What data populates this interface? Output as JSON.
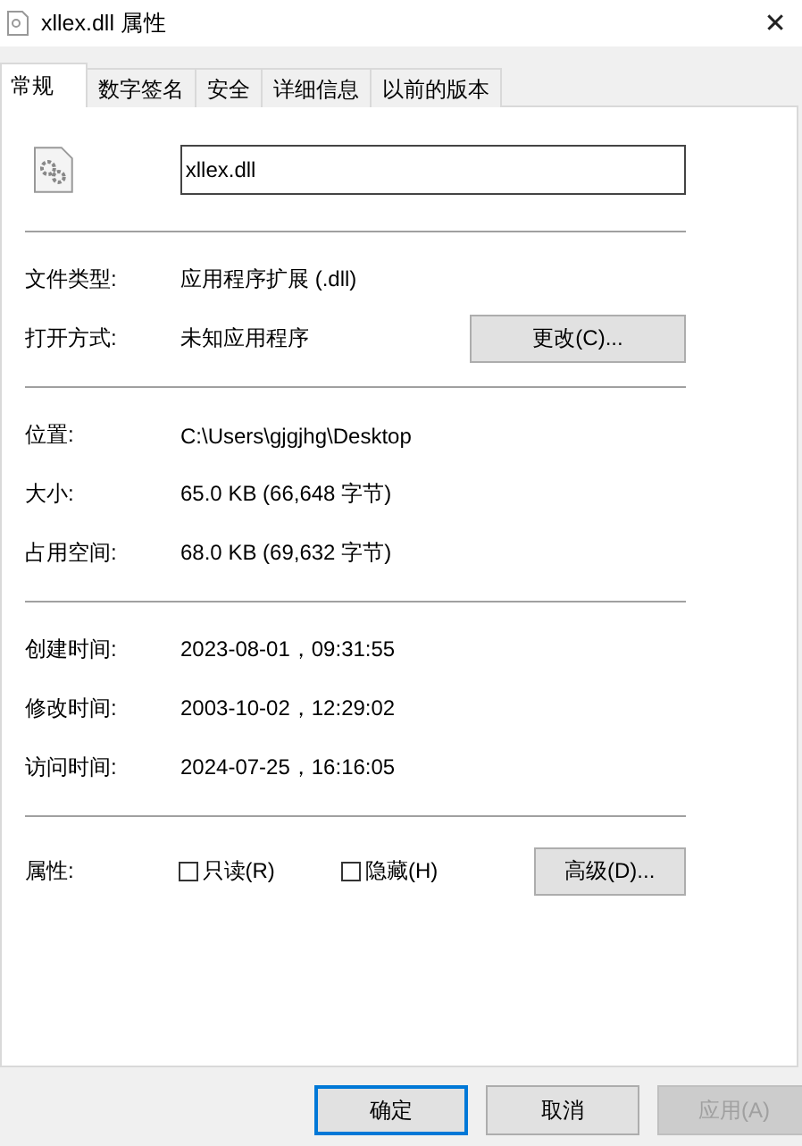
{
  "window": {
    "title": "xllex.dll 属性",
    "close": "✕"
  },
  "tabs": [
    {
      "label": "常规",
      "selected": true
    },
    {
      "label": "数字签名",
      "selected": false
    },
    {
      "label": "安全",
      "selected": false
    },
    {
      "label": "详细信息",
      "selected": false
    },
    {
      "label": "以前的版本",
      "selected": false
    }
  ],
  "file_name": "xllex.dll",
  "sections": [
    {
      "rows": [
        {
          "label": "文件类型:",
          "value": "应用程序扩展 (.dll)"
        },
        {
          "label": "打开方式:",
          "value": "未知应用程序",
          "button": "更改(C)..."
        }
      ]
    },
    {
      "rows": [
        {
          "label": "位置:",
          "value": "C:\\Users\\gjgjhg\\Desktop"
        },
        {
          "label": "大小:",
          "value": "65.0 KB (66,648 字节)"
        },
        {
          "label": "占用空间:",
          "value": "68.0 KB (69,632 字节)"
        }
      ]
    },
    {
      "rows": [
        {
          "label": "创建时间:",
          "value": "2023-08-01，09:31:55"
        },
        {
          "label": "修改时间:",
          "value": "2003-10-02，12:29:02"
        },
        {
          "label": "访问时间:",
          "value": "2024-07-25，16:16:05"
        }
      ]
    }
  ],
  "attributes": {
    "label": "属性:",
    "checkboxes": [
      {
        "label": "只读(R)",
        "checked": false
      },
      {
        "label": "隐藏(H)",
        "checked": false
      }
    ],
    "button": "高级(D)..."
  },
  "buttons": [
    {
      "label": "确定",
      "kind": "default",
      "disabled": false
    },
    {
      "label": "取消",
      "kind": "normal",
      "disabled": false
    },
    {
      "label": "应用(A)",
      "kind": "normal",
      "disabled": true
    }
  ]
}
